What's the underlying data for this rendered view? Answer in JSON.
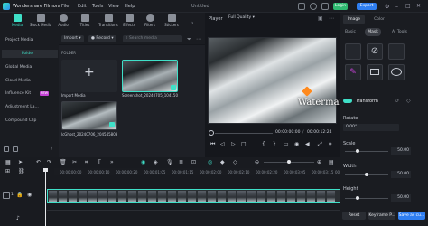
{
  "app": {
    "name": "Wondershare Filmora",
    "file_title": "Untitled",
    "menu": [
      "File",
      "Edit",
      "Tools",
      "View",
      "Help"
    ],
    "login": "Login",
    "export": "Export"
  },
  "toolbar": {
    "items": [
      "Media",
      "Stock Media",
      "Audio",
      "Titles",
      "Transitions",
      "Effects",
      "Filters",
      "Stickers"
    ]
  },
  "sidebar": {
    "items": [
      "Project Media",
      "Folder",
      "Global Media",
      "Cloud Media",
      "Influence Kit",
      "Adjustment La...",
      "Compound Clip"
    ],
    "badge": "NEW"
  },
  "mediabar": {
    "import": "Import",
    "record": "Record",
    "search_placeholder": "Search media"
  },
  "media": {
    "folder_label": "FOLDER",
    "import_label": "Import Media",
    "items": [
      "Screenshot_20240705_104150",
      "lcGhost_20240706_204545803"
    ]
  },
  "player": {
    "label": "Player",
    "quality": "Full Quality",
    "time_current": "00:00:00:00",
    "time_total": "00:00:12:24",
    "watermark": "Watermark"
  },
  "rightpanel": {
    "tabs": [
      "Image",
      "Color"
    ],
    "subtabs": [
      "Basic",
      "Mask",
      "AI Tools"
    ],
    "transform": "Transform",
    "rotate": "Rotate",
    "rotate_value": "0.00°",
    "scale": "Scale",
    "scale_value": "50.00",
    "width": "Width",
    "width_value": "50.00",
    "height": "Height",
    "height_value": "50.00",
    "reset": "Reset",
    "keyframe": "Keyframe P...",
    "save": "Save as cu..."
  },
  "timeline": {
    "ticks": [
      "00:00:00:00",
      "00:00:00:10",
      "00:00:00:20",
      "00:00:01:05",
      "00:00:01:15",
      "00:00:02:00",
      "00:00:02:10",
      "00:00:02:20",
      "00:00:03:05",
      "00:00:03:15",
      "00:00:04:00"
    ],
    "track_number": "1"
  },
  "colors": {
    "accent": "#3fe0c8",
    "login": "#2fb870",
    "export": "#2f7ef0"
  }
}
